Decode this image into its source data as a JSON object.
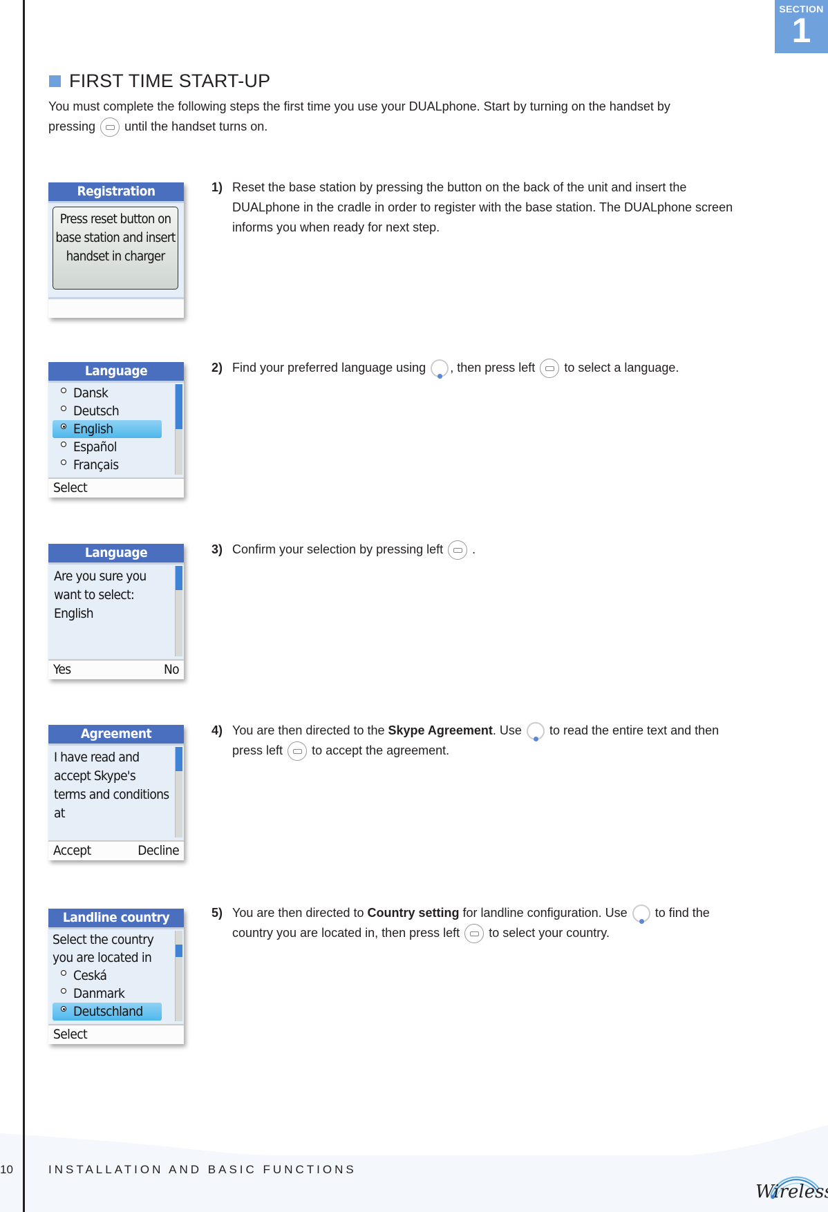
{
  "section_tab": {
    "label": "SECTION",
    "number": "1"
  },
  "title": "FIRST TIME START-UP",
  "intro": {
    "before_icon": "You must complete the following steps the first time you use your DUALphone. Start by turning on the handset by pressing",
    "icon": "end-call-button-icon",
    "after_icon": "until the handset turns on."
  },
  "steps": [
    {
      "number": "1)",
      "text": "Reset the base station by pressing the button on the back of the unit and insert the DUALphone in the cradle in order to register with the base station. The DUALphone screen informs you when ready for next step.",
      "screen": {
        "title": "Registration",
        "message": [
          "Press reset button on",
          "base station and insert",
          "handset in charger"
        ]
      }
    },
    {
      "number": "2)",
      "text_parts": [
        "Find your preferred language using",
        ", then press left",
        "to select a language."
      ],
      "screen": {
        "title": "Language",
        "options": [
          "Dansk",
          "Deutsch",
          "English",
          "Español",
          "Français"
        ],
        "selected_index": 2,
        "softkey_left": "Select",
        "scroll_position": 0.0
      }
    },
    {
      "number": "3)",
      "text_parts": [
        "Confirm your selection by pressing left",
        "."
      ],
      "screen": {
        "title": "Language",
        "lines": [
          "Are you sure you",
          "want to select:",
          "English"
        ],
        "softkey_left": "Yes",
        "softkey_right": "No"
      }
    },
    {
      "number": "4)",
      "text_parts": [
        "You are then directed to the",
        "Skype Agreement",
        ". Use",
        "to read the entire text and then press left",
        "to accept the agreement."
      ],
      "screen": {
        "title": "Agreement",
        "lines": [
          "I have read and",
          "accept Skype's",
          "terms and conditions",
          "at"
        ],
        "softkey_left": "Accept",
        "softkey_right": "Decline"
      }
    },
    {
      "number": "5)",
      "text_parts": [
        "You are then directed to",
        "Country setting",
        "for landline configuration. Use",
        "to find the country you are located in, then press left",
        "to select your country."
      ],
      "screen": {
        "title": "Landline country",
        "lines": [
          "Select the country",
          "you are located in"
        ],
        "options": [
          "Ceská",
          "Danmark",
          "Deutschland"
        ],
        "selected_index": 2,
        "softkey_left": "Select"
      }
    }
  ],
  "footer": {
    "page_number": "10",
    "section_title": "INSTALLATION AND BASIC FUNCTIONS",
    "logo_text": "Wireless"
  },
  "colors": {
    "accent": "#6fa1dc",
    "screen_header": "#4a6fbe",
    "selection": "#4eb7ec"
  }
}
